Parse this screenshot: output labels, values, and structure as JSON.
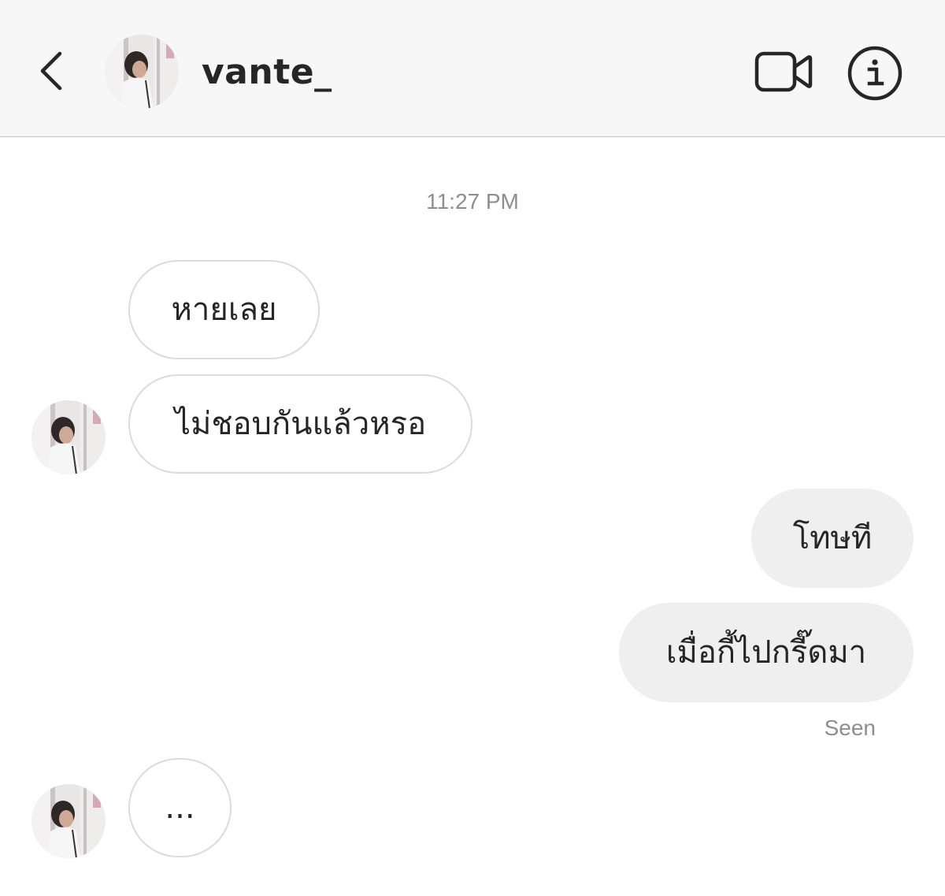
{
  "header": {
    "username": "vante_"
  },
  "conversation": {
    "timestamp": "11:27 PM",
    "messages": [
      {
        "direction": "incoming",
        "text": "หายเลย"
      },
      {
        "direction": "incoming",
        "text": "ไม่ชอบกันแล้วหรอ"
      },
      {
        "direction": "outgoing",
        "text": "โทษที"
      },
      {
        "direction": "outgoing",
        "text": "เมื่อกี้ไปกรี๊ดมา"
      },
      {
        "direction": "incoming",
        "text": "..."
      }
    ],
    "seen_label": "Seen"
  },
  "colors": {
    "header_bg": "#f7f7f7",
    "incoming_border": "#dbdbdb",
    "outgoing_bg": "#efefef",
    "muted_text": "#8e8e8e",
    "icon_color": "#262626"
  },
  "icons": {
    "back": "chevron-left-icon",
    "video": "video-camera-icon",
    "info": "info-icon",
    "avatar": "profile-photo"
  }
}
